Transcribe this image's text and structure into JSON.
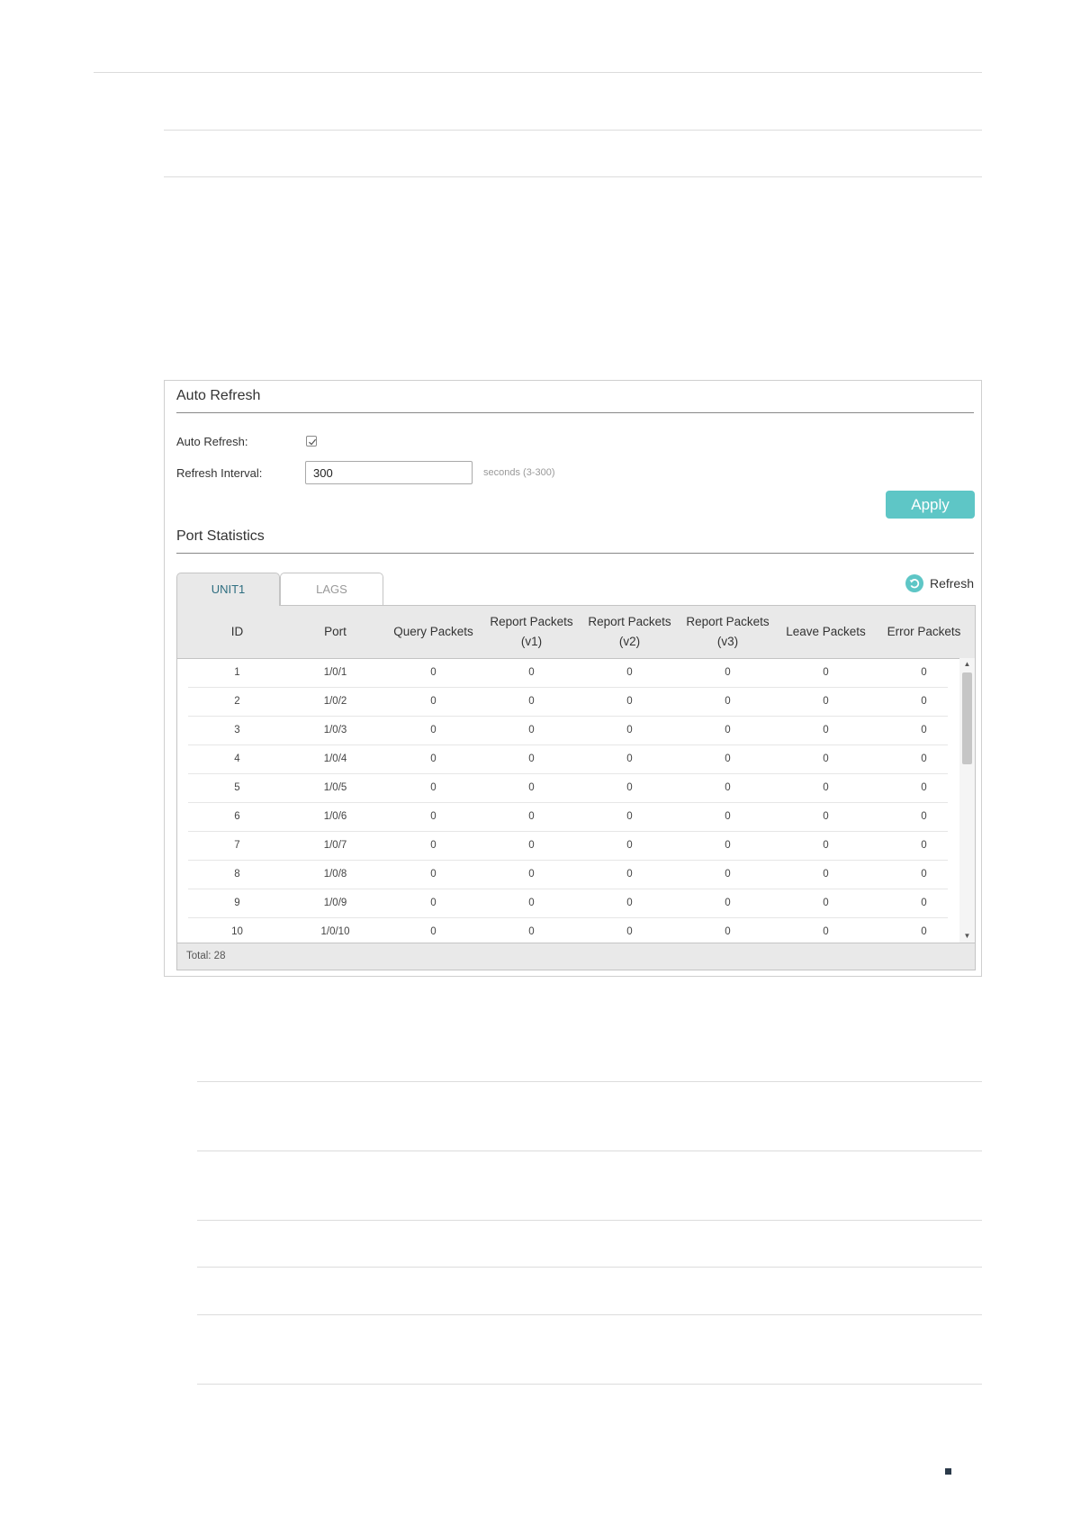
{
  "auto_refresh": {
    "title": "Auto Refresh",
    "auto_refresh_label": "Auto Refresh:",
    "auto_refresh_checked": true,
    "interval_label": "Refresh Interval:",
    "interval_value": "300",
    "interval_hint": "seconds (3-300)",
    "apply_label": "Apply"
  },
  "port_statistics": {
    "title": "Port Statistics",
    "tabs": [
      {
        "label": "UNIT1",
        "active": true
      },
      {
        "label": "LAGS",
        "active": false
      }
    ],
    "refresh_label": "Refresh",
    "columns": [
      {
        "line1": "ID",
        "line2": ""
      },
      {
        "line1": "Port",
        "line2": ""
      },
      {
        "line1": "Query Packets",
        "line2": ""
      },
      {
        "line1": "Report Packets",
        "line2": "(v1)"
      },
      {
        "line1": "Report Packets",
        "line2": "(v2)"
      },
      {
        "line1": "Report Packets",
        "line2": "(v3)"
      },
      {
        "line1": "Leave Packets",
        "line2": ""
      },
      {
        "line1": "Error Packets",
        "line2": ""
      }
    ],
    "rows": [
      [
        "1",
        "1/0/1",
        "0",
        "0",
        "0",
        "0",
        "0",
        "0"
      ],
      [
        "2",
        "1/0/2",
        "0",
        "0",
        "0",
        "0",
        "0",
        "0"
      ],
      [
        "3",
        "1/0/3",
        "0",
        "0",
        "0",
        "0",
        "0",
        "0"
      ],
      [
        "4",
        "1/0/4",
        "0",
        "0",
        "0",
        "0",
        "0",
        "0"
      ],
      [
        "5",
        "1/0/5",
        "0",
        "0",
        "0",
        "0",
        "0",
        "0"
      ],
      [
        "6",
        "1/0/6",
        "0",
        "0",
        "0",
        "0",
        "0",
        "0"
      ],
      [
        "7",
        "1/0/7",
        "0",
        "0",
        "0",
        "0",
        "0",
        "0"
      ],
      [
        "8",
        "1/0/8",
        "0",
        "0",
        "0",
        "0",
        "0",
        "0"
      ],
      [
        "9",
        "1/0/9",
        "0",
        "0",
        "0",
        "0",
        "0",
        "0"
      ],
      [
        "10",
        "1/0/10",
        "0",
        "0",
        "0",
        "0",
        "0",
        "0"
      ]
    ],
    "total_label": "Total: 28"
  },
  "colors": {
    "accent": "#5ec6c6",
    "tab_active_text": "#2e6e80",
    "header_bg": "#e9e9e9"
  },
  "icons": {
    "refresh": "refresh-circle-icon",
    "checkbox": "check-icon",
    "scroll_up": "scroll-up-arrow-icon",
    "scroll_down": "scroll-down-arrow-icon"
  }
}
